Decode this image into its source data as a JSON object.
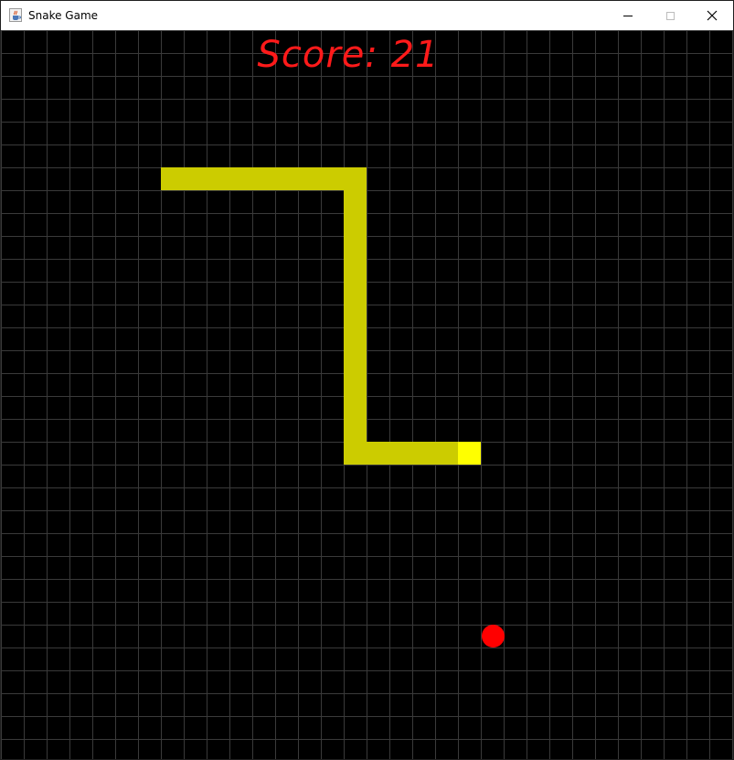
{
  "window": {
    "title": "Snake Game",
    "icon": "java-cup-icon",
    "controls": [
      "minimize-icon",
      "maximize-icon",
      "close-icon"
    ]
  },
  "game": {
    "score_text": "Score: 21",
    "colors": {
      "background": "#000000",
      "grid": "#3a3a3a",
      "snake_body": "#cccc00",
      "snake_head": "#ffff00",
      "food": "#ff0000",
      "score": "#ff1a1a"
    }
  }
}
